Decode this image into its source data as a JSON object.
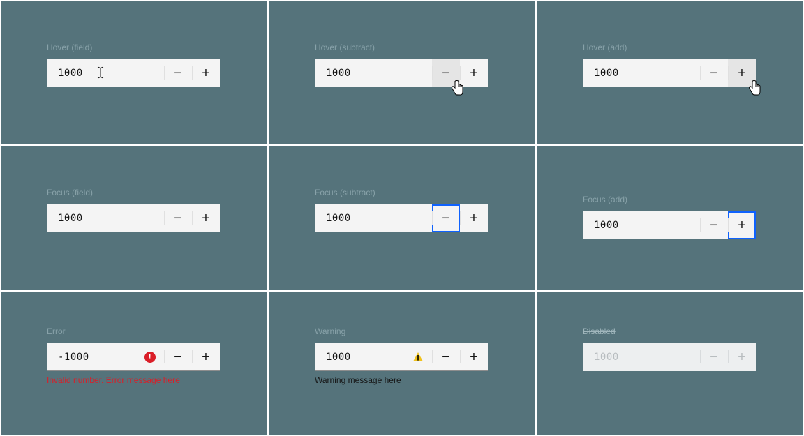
{
  "states": {
    "hover_field": {
      "label": "Hover (field)",
      "value": "1000"
    },
    "hover_subtract": {
      "label": "Hover (subtract)",
      "value": "1000"
    },
    "hover_add": {
      "label": "Hover (add)",
      "value": "1000"
    },
    "focus_field": {
      "label": "Focus (field)",
      "value": "1000"
    },
    "focus_subtract": {
      "label": "Focus (subtract)",
      "value": "1000"
    },
    "focus_add": {
      "label": "Focus (add)",
      "value": "1000"
    },
    "error": {
      "label": "Error",
      "value": "-1000",
      "helper": "Invalid number. Error message here"
    },
    "warning": {
      "label": "Warning",
      "value": "1000",
      "helper": "Warning message here"
    },
    "disabled": {
      "label": "Disabled",
      "value": "1000"
    }
  },
  "glyphs": {
    "minus": "−",
    "plus": "+"
  },
  "colors": {
    "background": "#55737B",
    "focus": "#0F62FE",
    "error": "#DA1E28",
    "warning": "#F1C21B",
    "field_bg": "#F4F4F4",
    "field_underline": "#8D8D8D",
    "hover_btn": "#E5E5E5"
  }
}
